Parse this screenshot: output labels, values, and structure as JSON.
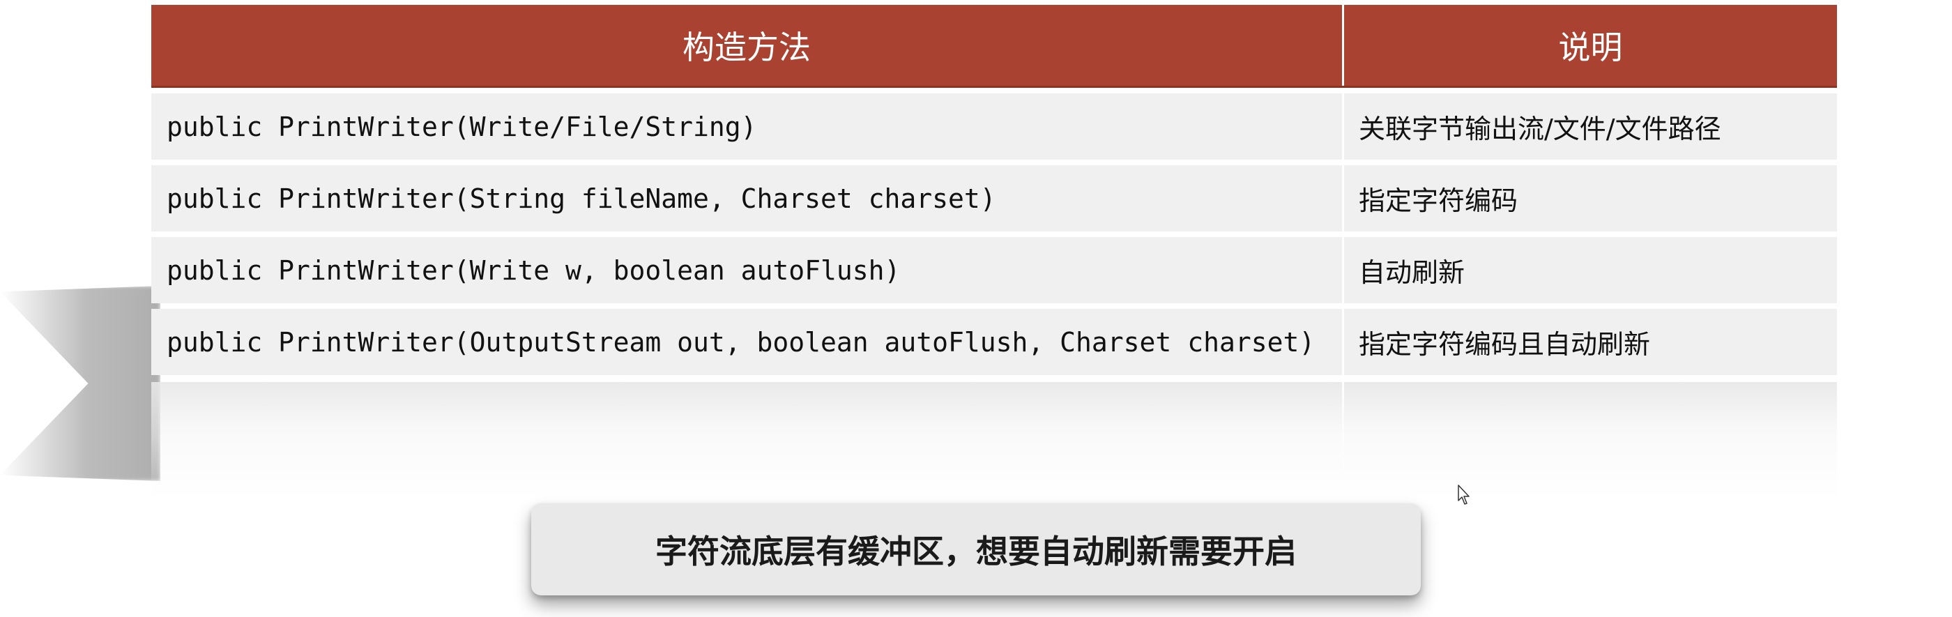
{
  "table": {
    "headers": [
      "构造方法",
      "说明"
    ],
    "rows": [
      {
        "method": "public PrintWriter(Write/File/String)",
        "desc": "关联字节输出流/文件/文件路径"
      },
      {
        "method": "public PrintWriter(String fileName, Charset charset)",
        "desc": "指定字符编码"
      },
      {
        "method": "public PrintWriter(Write w, boolean autoFlush)",
        "desc": "自动刷新"
      },
      {
        "method": "public PrintWriter(OutputStream out, boolean autoFlush, Charset charset)",
        "desc": "指定字符编码且自动刷新"
      }
    ]
  },
  "caption": {
    "text": "字符流底层有缓冲区，想要自动刷新需要开启"
  },
  "colors": {
    "header_bg": "#a94230",
    "header_text": "#ffffff",
    "row_bg": "#f0f0f0",
    "caption_bg": "#e9e9e9"
  },
  "icons": {
    "cursor": "mouse-pointer-icon"
  }
}
